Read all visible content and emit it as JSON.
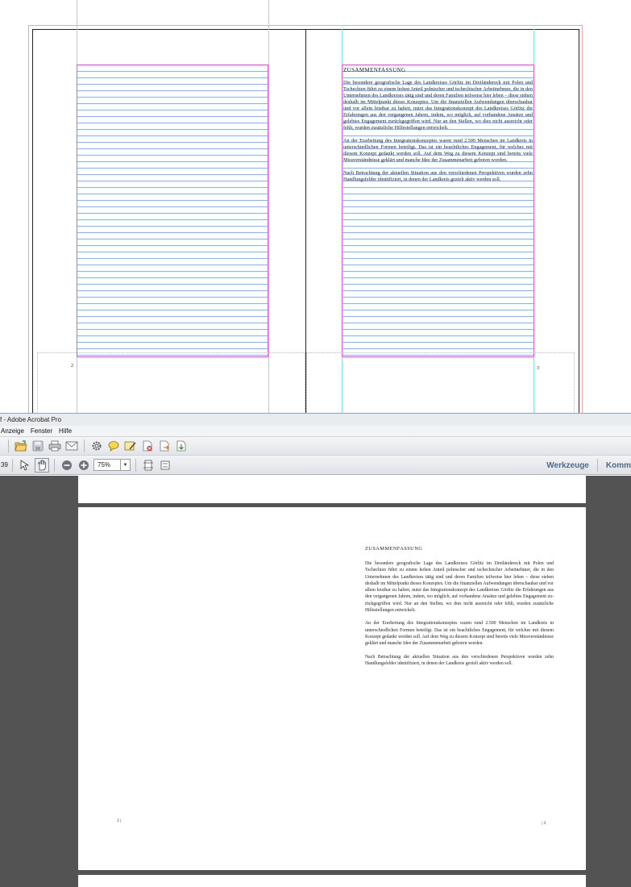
{
  "indesign_spread": {
    "heading": "ZUSAMMENFASSUNG",
    "paragraphs": [
      "Die besondere geografische Lage des Landkreises Görlitz im Dreiländereck mit Polen und Tschechien führt zu einem hohen Anteil polnischer und tschechischer Arbeitnehmer, die in den Unternehmen des Landkreises tätig sind und deren Familien teilweise hier leben – diese stehen deshalb im Mittelpunkt dieses Konzeptes. Um die finanziellen Aufwendungen überschaubar und vor allem leistbar zu halten, nutzt das Integrationskonzept des Landkreises Görlitz die Erfahrungen aus den vergangenen Jahren, indem, wo möglich, auf vorhandene Ansätze und gelebtes Engagement zurückgegriffen wird. Nur an den Stellen, wo dies nicht ausreicht oder fehlt, wurden zusätzliche Hilfestellungen entwickelt.",
      "An der Erarbeitung des Integrationskonzeptes waren rund 2.500 Menschen im Landkreis in unterschiedlichen Formen beteiligt. Das ist ein beachtliches Engagement, für welches mit diesem Konzept gedankt werden soll. Auf dem Weg zu diesem Konzept sind bereits viele Missverständnisse geklärt und manche Idee der Zusammenarbeit geboren worden.",
      "Nach Betrachtung der aktuellen Situation aus den verschiedenen Perspektiven wurden zehn Handlungsfelder identifiziert, in denen der Landkreis gezielt aktiv werden soll."
    ],
    "page_left": "2",
    "page_right": "3"
  },
  "acrobat": {
    "title": "f - Adobe Acrobat Pro",
    "menu": [
      "Anzeige",
      "Fenster",
      "Hilfe"
    ],
    "page_number": "39",
    "zoom": "75%",
    "right_tools": [
      "Werkzeuge",
      "Komm"
    ],
    "document": {
      "heading": "ZUSAMMENFASSUNG",
      "paragraphs": [
        "Die besondere geografische Lage des Landkreises Görlitz im Dreiländereck mit Polen und Tschechien führt zu einem hohen Anteil polnischer und tschechischer Arbeitnehmer, die in den Unternehmen des Landkreises tä­tig sind und deren Familien teilweise hier leben – diese stehen deshalb im Mittelpunkt dieses Konzeptes. Um die finanziellen Aufwendungen über­schaubar und vor allem leistbar zu halten, nutzt das Integrationskonzept des Landkreises Görlitz die Erfahrungen aus den vergangenen Jahren, in­dem, wo möglich, auf vorhandene Ansätze und gelebtes Engagement zu­rückgegriffen wird. Nur an den Stellen, wo dies nicht ausreicht oder fehlt, wurden zusätzliche Hilfestellungen entwickelt.",
        "An der Erarbeitung des Integrationskonzeptes waren rund 2.500 Menschen im Landkreis in unterschiedlichen Formen beteiligt. Das ist ein beachtli­ches Engagement, für welches mit diesem Konzept gedankt werden soll. Auf dem Weg zu diesem Konzept sind bereits viele Missverständnisse ge­klärt und manche Idee der Zusammenarbeit geboren worden.",
        "Nach Betrachtung der aktuellen Situation aus den verschiedenen Perspek­tiven wurden zehn Handlungsfelder identifiziert, in denen der Landkreis gezielt aktiv werden soll."
      ],
      "page_left": "2 |",
      "page_right": "| 3"
    }
  },
  "colors": {
    "guide_cyan": "#7fe3f0",
    "frame_magenta": "#e05ad6",
    "baseline_blue": "#8fb0f0",
    "bleed_red": "#f2a4a4",
    "viewer_gray": "#535353",
    "tools_blue": "#4a6d8c"
  },
  "icons": [
    "open-folder-icon",
    "save-icon",
    "print-icon",
    "email-icon",
    "settings-icon",
    "comment-icon",
    "sign-icon",
    "pdf-delete-icon",
    "export-icon",
    "import-icon",
    "select-cursor-icon",
    "hand-tool-icon",
    "zoom-out-icon",
    "zoom-in-icon",
    "fit-page-icon",
    "fit-width-icon"
  ]
}
